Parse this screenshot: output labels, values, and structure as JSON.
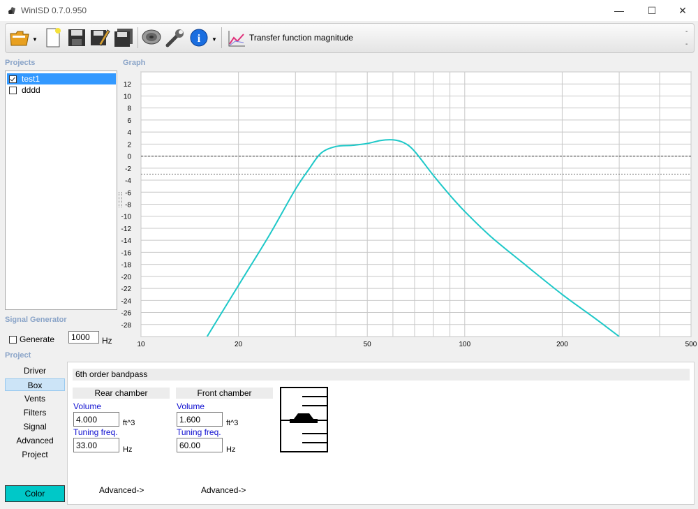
{
  "window": {
    "title": "WinISD 0.7.0.950",
    "minimize": "—",
    "maximize": "☐",
    "close": "✕"
  },
  "toolbar": {
    "chart_label": "Transfer function magnitude",
    "right_markers": [
      "-",
      "-"
    ],
    "buttons": [
      "open-folder-icon",
      "new-document-icon",
      "save-icon",
      "save-as-icon",
      "save-all-icon",
      "speaker-icon",
      "wrench-icon",
      "info-icon",
      "chart-icon"
    ]
  },
  "projects": {
    "header": "Projects",
    "items": [
      {
        "name": "test1",
        "checked": true,
        "selected": true
      },
      {
        "name": "dddd",
        "checked": false,
        "selected": false
      }
    ]
  },
  "graph": {
    "header": "Graph"
  },
  "signal_generator": {
    "header": "Signal Generator",
    "generate_label": "Generate",
    "frequency": "1000",
    "unit": "Hz"
  },
  "project_nav": {
    "header": "Project",
    "items": [
      "Driver",
      "Box",
      "Vents",
      "Filters",
      "Signal",
      "Advanced",
      "Project"
    ],
    "selected": "Box",
    "color_button": "Color"
  },
  "box": {
    "type": "6th order bandpass",
    "rear": {
      "header": "Rear chamber",
      "volume_label": "Volume",
      "volume": "4.000",
      "volume_unit": "ft^3",
      "tuning_label": "Tuning freq.",
      "tuning": "33.00",
      "tuning_unit": "Hz",
      "advanced": "Advanced->"
    },
    "front": {
      "header": "Front chamber",
      "volume_label": "Volume",
      "volume": "1.600",
      "volume_unit": "ft^3",
      "tuning_label": "Tuning freq.",
      "tuning": "60.00",
      "tuning_unit": "Hz",
      "advanced": "Advanced->"
    }
  },
  "chart_data": {
    "type": "line",
    "x_scale": "log",
    "xlim": [
      10,
      500
    ],
    "ylim": [
      -30,
      14
    ],
    "x_ticks": [
      10,
      20,
      50,
      100,
      200,
      500
    ],
    "y_ticks": [
      12,
      10,
      8,
      6,
      4,
      2,
      0,
      -2,
      -4,
      -6,
      -8,
      -10,
      -12,
      -14,
      -16,
      -18,
      -20,
      -22,
      -24,
      -26,
      -28
    ],
    "reference_lines": [
      0,
      -3
    ],
    "grid": true,
    "series": [
      {
        "color": "#1ec8c8",
        "x": [
          16,
          20,
          25,
          30,
          33,
          36,
          40,
          45,
          50,
          55,
          60,
          65,
          70,
          80,
          90,
          100,
          120,
          150,
          200,
          250,
          300
        ],
        "y": [
          -30,
          -21.5,
          -13,
          -5.5,
          -2.2,
          0.5,
          1.6,
          1.8,
          2.1,
          2.6,
          2.7,
          2.2,
          0.8,
          -3.2,
          -6.5,
          -9.2,
          -13.3,
          -17.6,
          -23,
          -26.8,
          -30
        ]
      }
    ]
  }
}
